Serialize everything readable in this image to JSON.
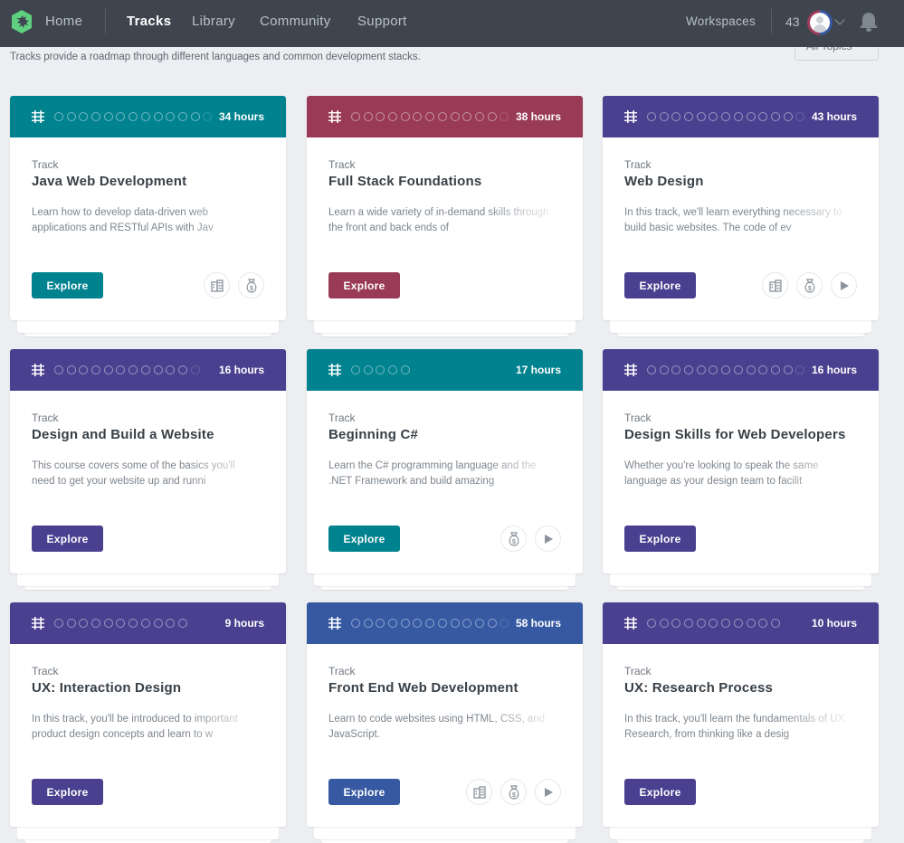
{
  "nav": {
    "logo": "treehouse-logo",
    "home": "Home",
    "items": [
      "Tracks",
      "Library",
      "Community",
      "Support"
    ],
    "active": "Tracks",
    "workspaces": "Workspaces",
    "points": "43"
  },
  "filter": {
    "selected": "All Topics"
  },
  "intro": "Tracks provide a roadmap through different languages and common development stacks.",
  "cards": [
    {
      "type": "Track",
      "title": "Java Web Development",
      "hours": "34 hours",
      "color": "#00828f",
      "dots": 13,
      "description": "Learn how to develop data-driven web applications and RESTful APIs with Jav",
      "explore": "Explore",
      "resources": [
        "workspace-icon",
        "money-bag-icon"
      ]
    },
    {
      "type": "Track",
      "title": "Full Stack Foundations",
      "hours": "38 hours",
      "color": "#993a57",
      "dots": 13,
      "description": "Learn a wide variety of in-demand skills through the front and back ends of",
      "explore": "Explore",
      "resources": []
    },
    {
      "type": "Track",
      "title": "Web Design",
      "hours": "43 hours",
      "color": "#4a408f",
      "dots": 13,
      "description": "In this track, we'll learn everything necessary to build basic websites. The code of ev",
      "explore": "Explore",
      "resources": [
        "workspace-icon",
        "money-bag-icon",
        "play-icon"
      ]
    },
    {
      "type": "Track",
      "title": "Design and Build a Website",
      "hours": "16 hours",
      "color": "#4a408f",
      "dots": 12,
      "description": "This course covers some of the basics you'll need to get your website up and runni",
      "explore": "Explore",
      "resources": []
    },
    {
      "type": "Track",
      "title": "Beginning C#",
      "hours": "17 hours",
      "color": "#00828f",
      "dots": 5,
      "description": "Learn the C# programming language and the .NET Framework and build amazing",
      "explore": "Explore",
      "resources": [
        "money-bag-icon",
        "play-icon"
      ]
    },
    {
      "type": "Track",
      "title": "Design Skills for Web Developers",
      "hours": "16 hours",
      "color": "#4a408f",
      "dots": 13,
      "description": "Whether you're looking to speak the same language as your design team to facilit",
      "explore": "Explore",
      "resources": []
    },
    {
      "type": "Track",
      "title": "UX: Interaction Design",
      "hours": "9 hours",
      "color": "#4a408f",
      "dots": 11,
      "description": "In this track, you'll be introduced to important product design concepts and learn to w",
      "explore": "Explore",
      "resources": []
    },
    {
      "type": "Track",
      "title": "Front End Web Development",
      "hours": "58 hours",
      "color": "#3659a2",
      "dots": 13,
      "description": "Learn to code websites using HTML, CSS, and JavaScript.",
      "explore": "Explore",
      "resources": [
        "workspace-icon",
        "money-bag-icon",
        "play-icon"
      ]
    },
    {
      "type": "Track",
      "title": "UX: Research Process",
      "hours": "10 hours",
      "color": "#4a408f",
      "dots": 11,
      "description": "In this track, you'll learn the fundamentals of UX Research, from thinking like a desig",
      "explore": "Explore",
      "resources": []
    }
  ]
}
